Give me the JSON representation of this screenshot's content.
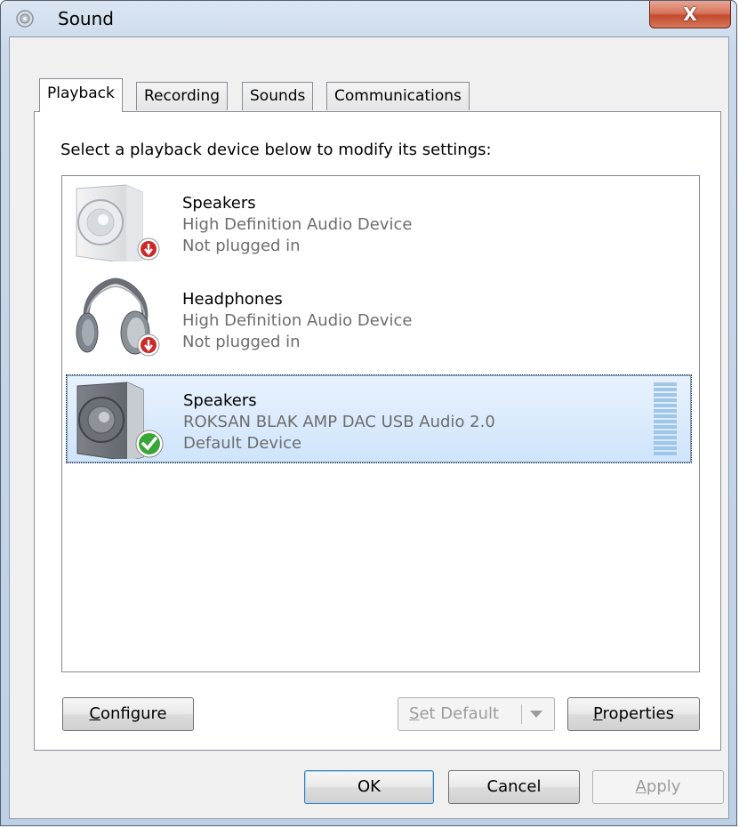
{
  "window": {
    "title": "Sound",
    "close_label": "X"
  },
  "tabs": [
    {
      "label": "Playback",
      "active": true
    },
    {
      "label": "Recording",
      "active": false
    },
    {
      "label": "Sounds",
      "active": false
    },
    {
      "label": "Communications",
      "active": false
    }
  ],
  "playback": {
    "instruction": "Select a playback device below to modify its settings:",
    "devices": [
      {
        "name": "Speakers",
        "description": "High Definition Audio Device",
        "status": "Not plugged in",
        "icon": "speaker-icon",
        "badge": "unplugged-badge-icon",
        "selected": false
      },
      {
        "name": "Headphones",
        "description": "High Definition Audio Device",
        "status": "Not plugged in",
        "icon": "headphones-icon",
        "badge": "unplugged-badge-icon",
        "selected": false
      },
      {
        "name": "Speakers",
        "description": "ROKSAN BLAK AMP DAC USB Audio 2.0",
        "status": "Default Device",
        "icon": "speaker-icon",
        "badge": "default-check-icon",
        "selected": true
      }
    ]
  },
  "buttons": {
    "configure": {
      "prefix": "",
      "mnemonic": "C",
      "rest": "onfigure"
    },
    "set_default": {
      "prefix": "",
      "mnemonic": "S",
      "rest": "et Default"
    },
    "properties": {
      "prefix": "",
      "mnemonic": "P",
      "rest": "roperties"
    },
    "ok": "OK",
    "cancel": "Cancel",
    "apply": {
      "prefix": "",
      "mnemonic": "A",
      "rest": "pply"
    }
  },
  "colors": {
    "selection": "#cfe4fb",
    "close_button": "#c24b2e",
    "unplugged_badge": "#cc2a2a",
    "default_badge": "#3aa63a"
  }
}
